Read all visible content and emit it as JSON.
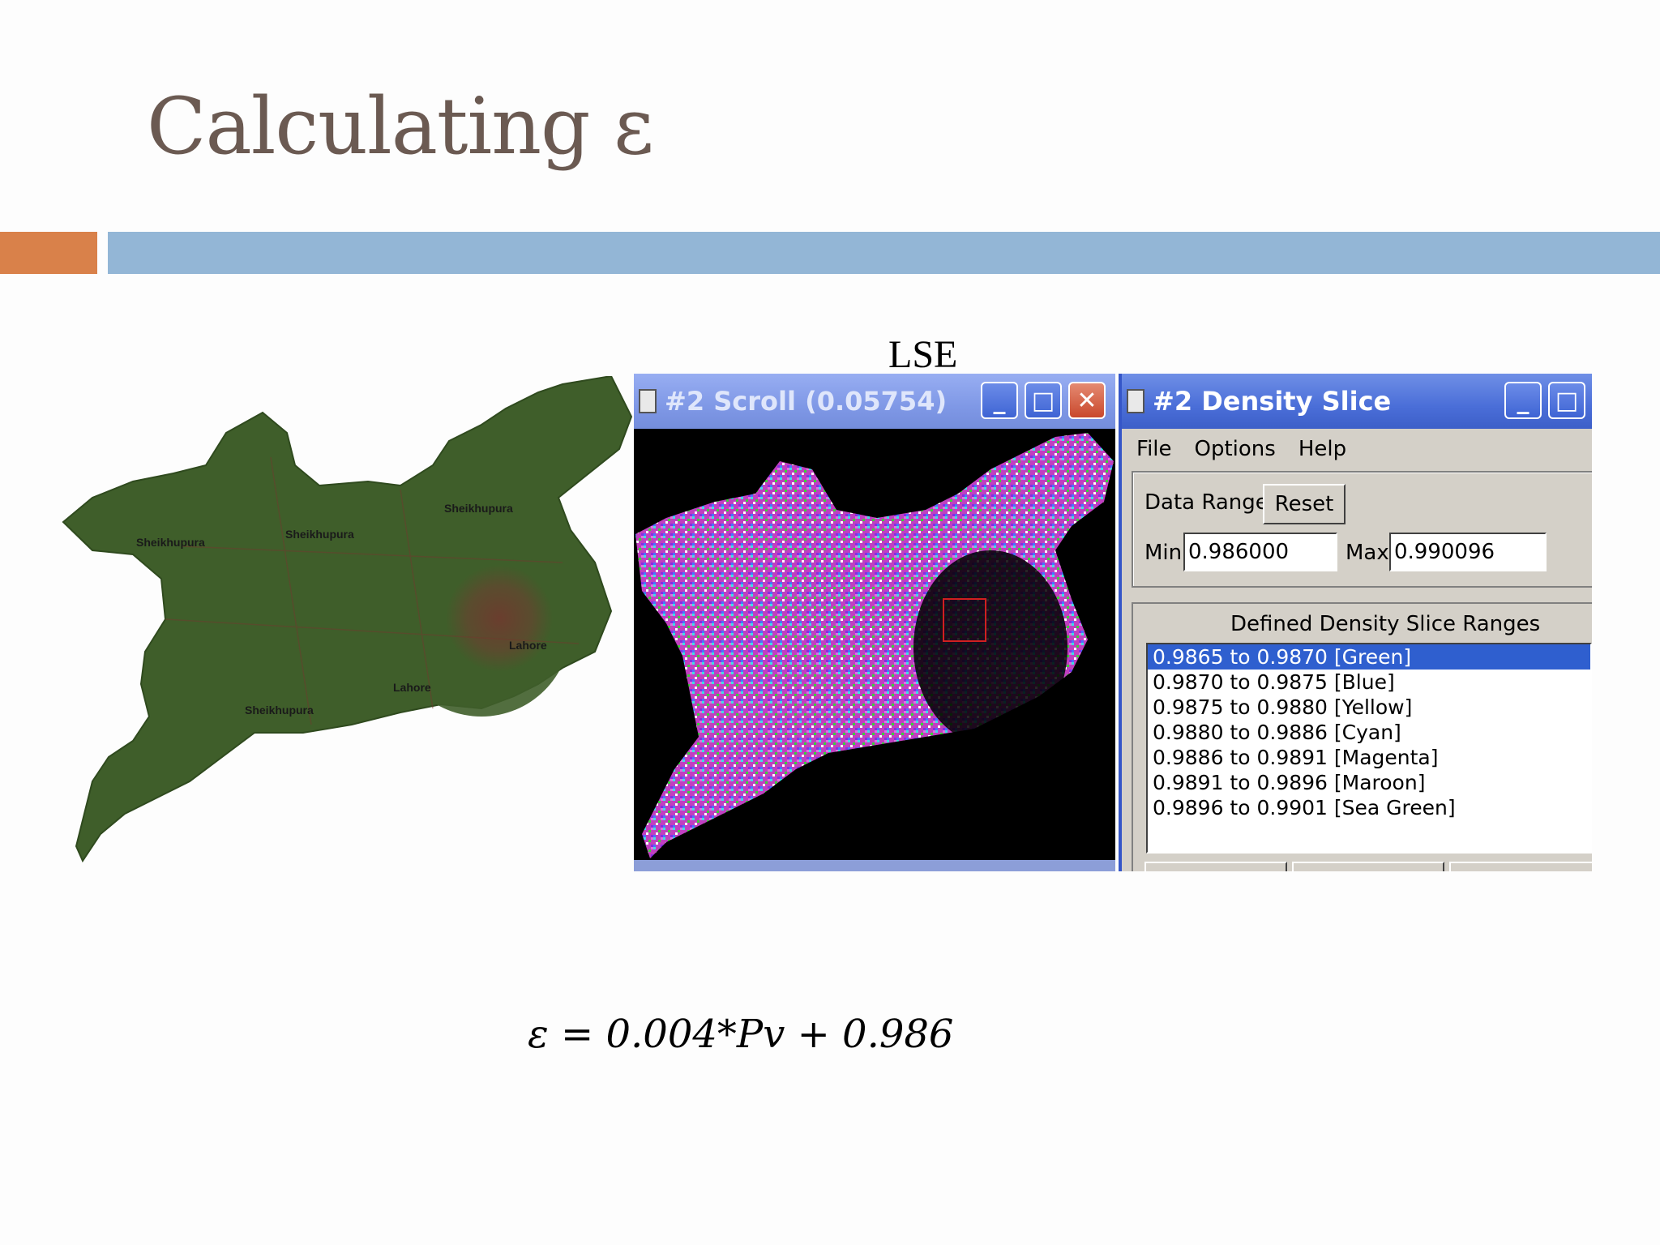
{
  "slide": {
    "title": "Calculating ε",
    "caption": "LSE",
    "formula": "ε = 0.004*Pv + 0.986"
  },
  "colors": {
    "title": "#6b5a52",
    "accent_orange": "#d9814a",
    "accent_blue": "#93b6d6",
    "map_green": "#3f5e2a",
    "urban_brown": "#6f3a2e"
  },
  "map": {
    "labels": [
      "Sheikhupura",
      "Sheikhupura",
      "Sheikhupura",
      "Lahore",
      "Lahore",
      "Sheikhupura"
    ]
  },
  "scroll_window": {
    "title": "#2 Scroll (0.05754)"
  },
  "density_slice": {
    "title": "#2 Density Slice",
    "menu": [
      "File",
      "Options",
      "Help"
    ],
    "data_range_label": "Data Range",
    "reset_label": "Reset",
    "min_label": "Min",
    "min_value": "0.986000",
    "max_label": "Max",
    "max_value": "0.990096",
    "ranges_header": "Defined Density Slice Ranges",
    "ranges": [
      "0.9865 to 0.9870 [Green]",
      "0.9870 to 0.9875 [Blue]",
      "0.9875 to 0.9880 [Yellow]",
      "0.9880 to 0.9886 [Cyan]",
      "0.9886 to 0.9891 [Magenta]",
      "0.9891 to 0.9896 [Maroon]",
      "0.9896 to 0.9901 [Sea Green]"
    ],
    "selected_index": 0
  }
}
